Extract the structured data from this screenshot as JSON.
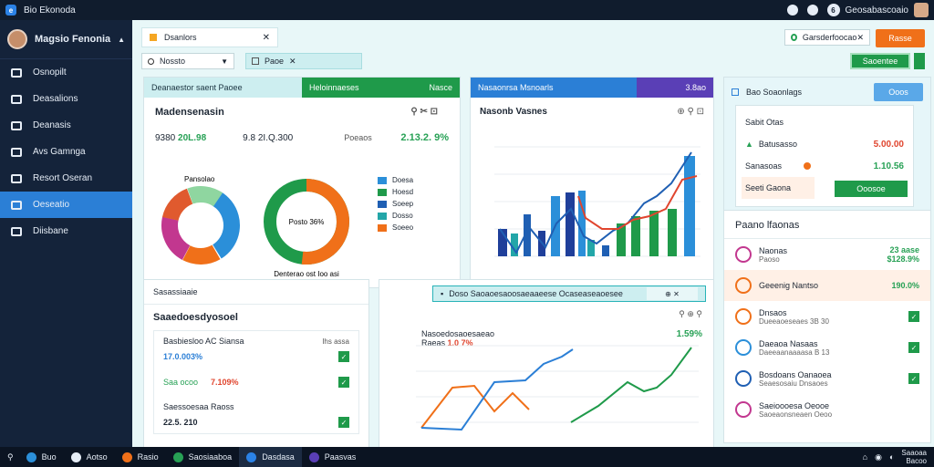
{
  "window": {
    "title": "Bio Ekonoda"
  },
  "topbar": {
    "user_badge": "6",
    "user_name": "Geosabascoaio"
  },
  "sidebar": {
    "profile_name": "Magsio Fenonia",
    "items": [
      {
        "label": "Osnopilt",
        "icon": "home-icon"
      },
      {
        "label": "Deasalions",
        "icon": "grid-icon"
      },
      {
        "label": "Deanasis",
        "icon": "card-icon"
      },
      {
        "label": "Avs Gamnga",
        "icon": "list-icon"
      },
      {
        "label": "Resort Oseran",
        "icon": "chart-icon"
      },
      {
        "label": "Oeseatio",
        "icon": "users-icon",
        "active": true
      },
      {
        "label": "Diisbane",
        "icon": "dashboard-icon"
      }
    ]
  },
  "toolbar": {
    "tab_label": "Dsanlors",
    "select_value": "Nossto",
    "search_value": "Paoe",
    "top_field": "Garsderfoocao",
    "orange_button": "Rasse",
    "green_button": "Saoentee"
  },
  "card1": {
    "header_left": "Deanaestor saent Paoee",
    "header_mid": "Heloinnaeses",
    "header_right": "Nasce",
    "subtitle": "Madensenasin",
    "actions": "⚲ ✂ ⊡",
    "stat1_prefix": "9380",
    "stat1_value": "20L.98",
    "stat2": "9.8 2I.Q.300",
    "stat3": "Poeaos",
    "stat4": "2.13.2. 9%",
    "pie_label": "Pansolao",
    "donut_center": "Posto 36%",
    "donut_footer": "Denterao ost Ioo asi",
    "legend": [
      {
        "name": "Doesa",
        "color": "#2b8fd9"
      },
      {
        "name": "Hoesd",
        "color": "#1f9a4a"
      },
      {
        "name": "Soeep",
        "color": "#1f5fb3"
      },
      {
        "name": "Dosso",
        "color": "#23a6a8"
      },
      {
        "name": "Soeeo",
        "color": "#f07019"
      }
    ]
  },
  "card2": {
    "header_left": "Nasaonrsa Msnoarls",
    "header_right": "3.8ao",
    "subtitle": "Nasonb Vasnes",
    "actions": "⊕ ⚲ ⊡"
  },
  "card3": {
    "title": "Bao Soaonlags",
    "button": "Ooos",
    "row1_label": "Sabit Otas",
    "row2_label": "Batusasso",
    "row2_value": "5.00.00",
    "row3_label": "Sanasoas",
    "row3_value": "1.10.56",
    "row4_label": "Seeti Gaona",
    "green_button": "Ooosoe"
  },
  "card4": {
    "title": "Paano lfaonas",
    "items": [
      {
        "t1": "Naonas",
        "t2": "Paoso",
        "v1": "23 aase",
        "v2": "$128.9%",
        "type": "value"
      },
      {
        "t1": "Geeenig Nantso",
        "t2": "",
        "v1": "190.0%",
        "v2": "",
        "type": "value",
        "highlight": true
      },
      {
        "t1": "Dnsaos",
        "t2": "Dueeaoeseaes 3B 30",
        "type": "check"
      },
      {
        "t1": "Daeaoa Nasaas",
        "t2": "Daeeaanaaaasa B 13",
        "type": "check"
      },
      {
        "t1": "Bosdoans Oanaoea",
        "t2": "Seaesosaiu Dnsaoes",
        "type": "check"
      },
      {
        "t1": "Saeioooesa Oeooe",
        "t2": "Saoeaonsneaen Oeoo",
        "type": "none"
      }
    ]
  },
  "card5": {
    "top": "Sasassiaaie",
    "subtitle": "Saaedoesdyosoel",
    "r1_label": "Basbiesloo AC Siansa",
    "r1_value": "17.0.003%",
    "r1_side": "Ihs assa",
    "r2_label": "Saa ocoo",
    "r2_value": "7.109%",
    "r3_label": "Saessoesaa Raoss",
    "r3_value": "22.5.  210"
  },
  "card6": {
    "band": "Doso Saoaoesaoosaeaaeese Ocaseaseaoesee",
    "band_button": "⊕ ✕",
    "actions": "⚲ ⊕ ⚲",
    "label_prefix": "Nasoedosaoesaeao",
    "label_line2": "Raeas",
    "label_red": "1.0  7%",
    "pct": "1.59%"
  },
  "taskbar": {
    "apps": [
      {
        "label": "Buo",
        "color": "#2b8fd9"
      },
      {
        "label": "Aotso",
        "color": "#e6edf6"
      },
      {
        "label": "Rasio",
        "color": "#f07019"
      },
      {
        "label": "Saosiaaboa",
        "color": "#27a155"
      },
      {
        "label": "Dasdasa",
        "color": "#2b82e6",
        "active": true
      },
      {
        "label": "Paasvas",
        "color": "#5a3fb6"
      }
    ],
    "time": "Saaoaa",
    "date": "Bacoo"
  }
}
